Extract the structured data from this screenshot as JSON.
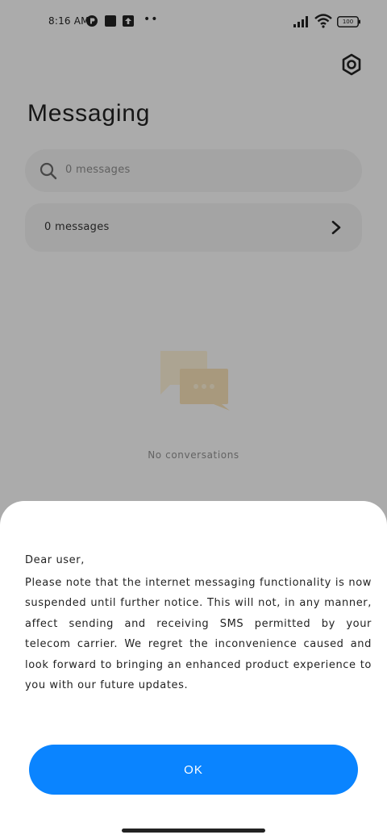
{
  "status_bar": {
    "time": "8:16 AM",
    "battery_level": "100"
  },
  "header": {
    "title": "Messaging",
    "settings_icon": "gear-icon"
  },
  "search": {
    "text": "0 messages",
    "icon": "search-icon"
  },
  "messages_row": {
    "label": "0 messages",
    "icon": "chevron-right-icon"
  },
  "empty_state": {
    "icon": "chat-bubbles-icon",
    "text": "No conversations"
  },
  "dialog": {
    "greeting": "Dear user,",
    "message": "Please note that the internet messaging functionality is now suspended until further notice. This will not, in any manner, affect sending and receiving SMS permitted by your telecom carrier. We regret the inconvenience caused and look forward to bringing an enhanced product experience to you with our future updates.",
    "ok_label": "OK",
    "accent_color": "#0a84ff"
  }
}
